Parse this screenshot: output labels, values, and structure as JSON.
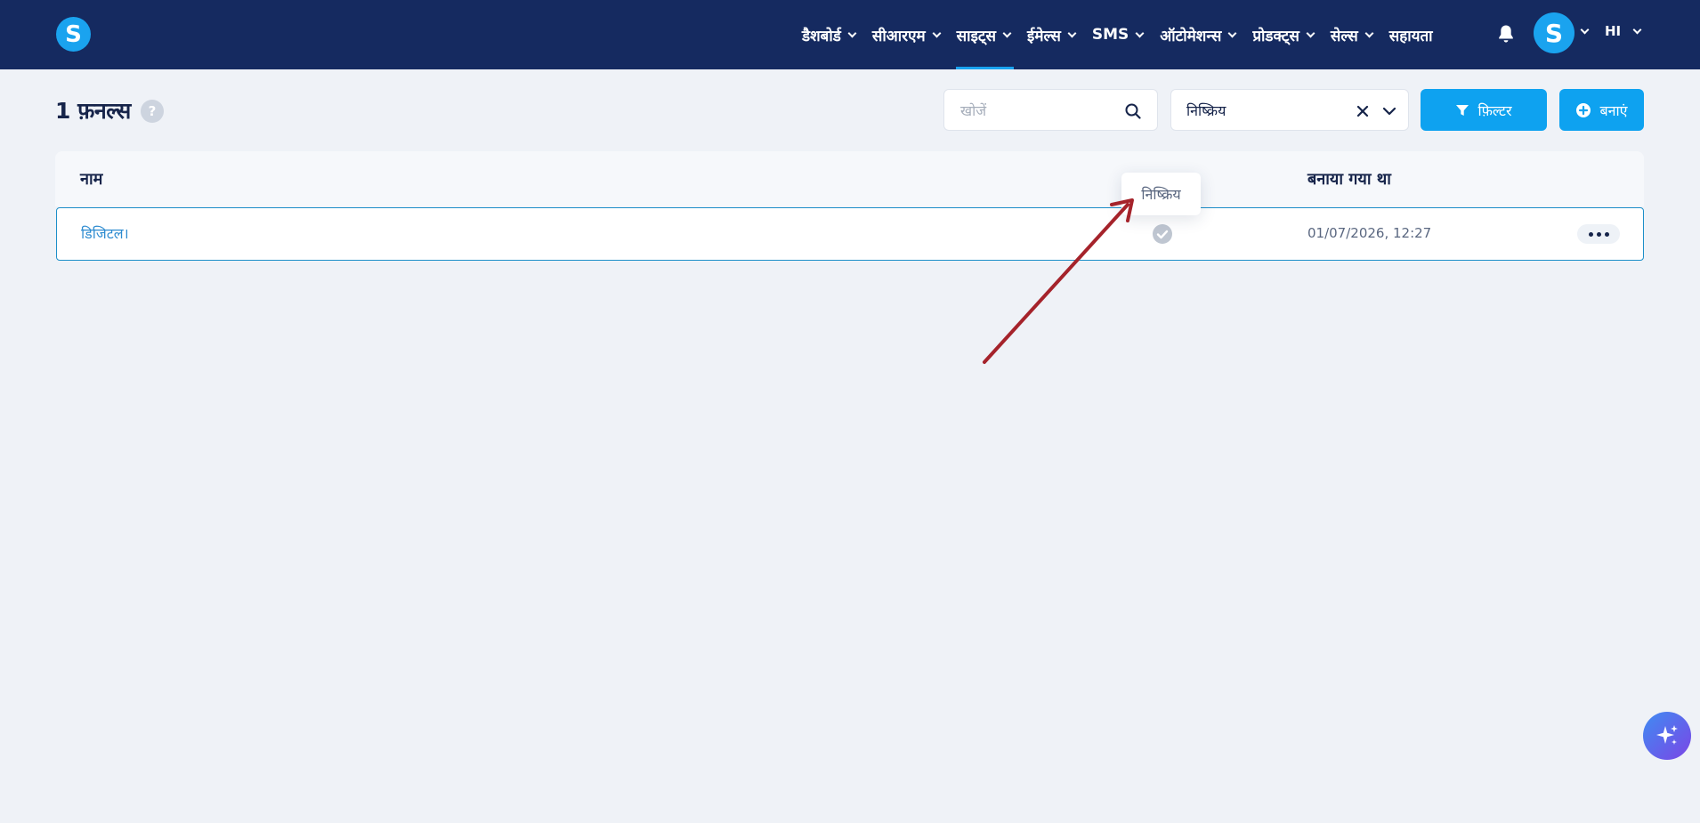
{
  "app": {
    "logo_letter": "S"
  },
  "nav": {
    "items": [
      {
        "label": "डैशबोर्ड",
        "active": false
      },
      {
        "label": "सीआरएम",
        "active": false
      },
      {
        "label": "साइट्स",
        "active": true
      },
      {
        "label": "ईमेल्स",
        "active": false
      },
      {
        "label": "SMS",
        "active": false
      },
      {
        "label": "ऑटोमेशन्स",
        "active": false
      },
      {
        "label": "प्रोडक्ट्स",
        "active": false
      },
      {
        "label": "सेल्स",
        "active": false
      }
    ],
    "help_label": "सहायता",
    "avatar_letter": "S",
    "language": "HI"
  },
  "page": {
    "title": "1 फ़नल्स",
    "help_badge": "?"
  },
  "search": {
    "placeholder": "खोजें",
    "value": ""
  },
  "status_filter": {
    "selected": "निष्क्रिय"
  },
  "buttons": {
    "filter": "फ़िल्टर",
    "create": "बनाएं"
  },
  "table": {
    "columns": {
      "name": "नाम",
      "created": "बनाया गया था"
    },
    "rows": [
      {
        "name": "डिजिटल।",
        "created": "01/07/2026, 12:27"
      }
    ]
  },
  "tooltip": {
    "text": "निष्क्रिय"
  },
  "colors": {
    "nav_bg": "#152a60",
    "accent": "#0ea2f0",
    "page_bg": "#eff2f7",
    "annotation_arrow": "#a5232b"
  }
}
